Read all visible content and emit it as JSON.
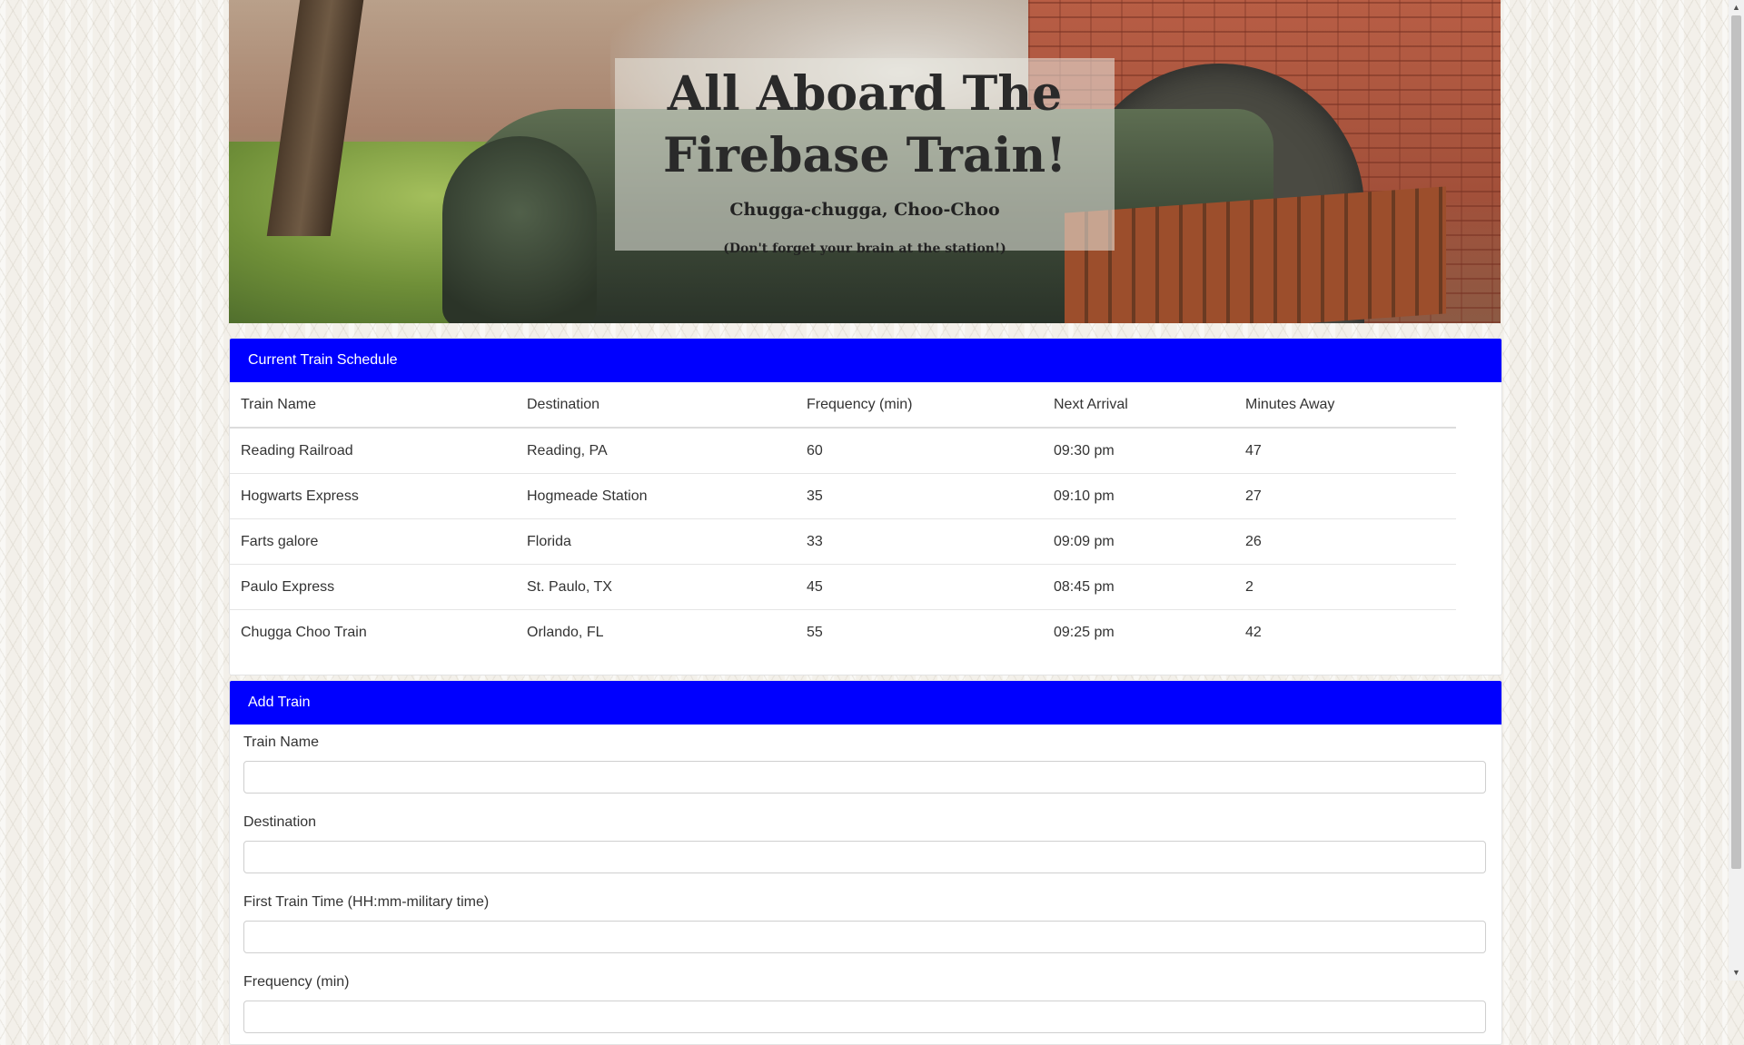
{
  "hero": {
    "title": "All Aboard The Firebase Train!",
    "subtitle": "Chugga-chugga, Choo-Choo",
    "note": "(Don't forget your brain at the station!)"
  },
  "schedule": {
    "header": "Current Train Schedule",
    "columns": [
      "Train Name",
      "Destination",
      "Frequency (min)",
      "Next Arrival",
      "Minutes Away"
    ],
    "rows": [
      [
        "Reading Railroad",
        "Reading, PA",
        "60",
        "09:30 pm",
        "47"
      ],
      [
        "Hogwarts Express",
        "Hogmeade Station",
        "35",
        "09:10 pm",
        "27"
      ],
      [
        "Farts galore",
        "Florida",
        "33",
        "09:09 pm",
        "26"
      ],
      [
        "Paulo Express",
        "St. Paulo, TX",
        "45",
        "08:45 pm",
        "2"
      ],
      [
        "Chugga Choo Train",
        "Orlando, FL",
        "55",
        "09:25 pm",
        "42"
      ]
    ]
  },
  "add_train": {
    "header": "Add Train",
    "fields": {
      "train_name": {
        "label": "Train Name",
        "value": ""
      },
      "destination": {
        "label": "Destination",
        "value": ""
      },
      "first_time": {
        "label": "First Train Time (HH:mm-military time)",
        "value": ""
      },
      "frequency": {
        "label": "Frequency (min)",
        "value": ""
      }
    }
  },
  "colors": {
    "header_bg": "#0000ff",
    "header_text": "#ffffff"
  },
  "icons": {
    "scroll_up": "triangle-up",
    "scroll_down": "triangle-down"
  }
}
